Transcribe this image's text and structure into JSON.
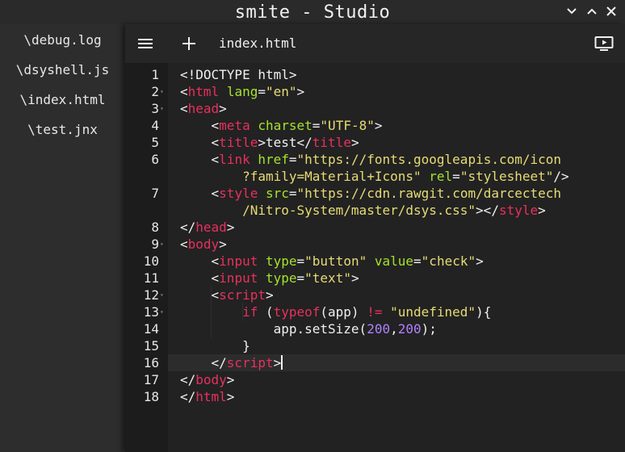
{
  "window": {
    "title": "smite - Studio",
    "controls": [
      "chevron-down-icon",
      "chevron-up-icon",
      "close-icon"
    ]
  },
  "sidebar": {
    "files": [
      "\\debug.log",
      "\\dsyshell.js",
      "\\index.html",
      "\\test.jnx"
    ]
  },
  "toolbar": {
    "menu_icon": "menu-icon",
    "add_icon": "plus-icon",
    "tab_label": "index.html",
    "run_icon": "play-screen-icon"
  },
  "editor": {
    "active_line": 16,
    "colors": {
      "tag": "#e8305e",
      "attribute": "#a6e22e",
      "string": "#e6db74",
      "number": "#ae81ff",
      "text": "#f0f0f0"
    },
    "lines": [
      {
        "num": "1",
        "fold": false,
        "wrap": false,
        "parts": [
          [
            "text",
            "<!DOCTYPE html>"
          ]
        ]
      },
      {
        "num": "2",
        "fold": true,
        "wrap": false,
        "parts": [
          [
            "text",
            "<"
          ],
          [
            "tag",
            "html"
          ],
          [
            "text",
            " "
          ],
          [
            "attr",
            "lang"
          ],
          [
            "text",
            "="
          ],
          [
            "str",
            "\"en\""
          ],
          [
            "text",
            ">"
          ]
        ]
      },
      {
        "num": "3",
        "fold": true,
        "wrap": false,
        "parts": [
          [
            "text",
            "<"
          ],
          [
            "tag",
            "head"
          ],
          [
            "text",
            ">"
          ]
        ]
      },
      {
        "num": "4",
        "fold": false,
        "wrap": false,
        "parts": [
          [
            "text",
            "    <"
          ],
          [
            "tag",
            "meta"
          ],
          [
            "text",
            " "
          ],
          [
            "attr",
            "charset"
          ],
          [
            "text",
            "="
          ],
          [
            "str",
            "\"UTF-8\""
          ],
          [
            "text",
            ">"
          ]
        ]
      },
      {
        "num": "5",
        "fold": false,
        "wrap": false,
        "parts": [
          [
            "text",
            "    <"
          ],
          [
            "tag",
            "title"
          ],
          [
            "text",
            ">test</"
          ],
          [
            "tag",
            "title"
          ],
          [
            "text",
            ">"
          ]
        ]
      },
      {
        "num": "6",
        "fold": false,
        "wrap": false,
        "parts": [
          [
            "text",
            "    <"
          ],
          [
            "tag",
            "link"
          ],
          [
            "text",
            " "
          ],
          [
            "attr",
            "href"
          ],
          [
            "text",
            "="
          ],
          [
            "str",
            "\"https://fonts.googleapis.com/icon"
          ]
        ]
      },
      {
        "num": "",
        "fold": false,
        "wrap": true,
        "parts": [
          [
            "text",
            "        "
          ],
          [
            "str",
            "?family=Material+Icons\""
          ],
          [
            "text",
            " "
          ],
          [
            "attr",
            "rel"
          ],
          [
            "text",
            "="
          ],
          [
            "str",
            "\"stylesheet\""
          ],
          [
            "text",
            "/>"
          ]
        ]
      },
      {
        "num": "7",
        "fold": false,
        "wrap": false,
        "parts": [
          [
            "text",
            "    <"
          ],
          [
            "tag",
            "style"
          ],
          [
            "text",
            " "
          ],
          [
            "attr",
            "src"
          ],
          [
            "text",
            "="
          ],
          [
            "str",
            "\"https://cdn.rawgit.com/darcectech"
          ]
        ]
      },
      {
        "num": "",
        "fold": false,
        "wrap": true,
        "parts": [
          [
            "text",
            "        "
          ],
          [
            "str",
            "/Nitro-System/master/dsys.css\""
          ],
          [
            "text",
            "></"
          ],
          [
            "tag",
            "style"
          ],
          [
            "text",
            ">"
          ]
        ]
      },
      {
        "num": "8",
        "fold": false,
        "wrap": false,
        "parts": [
          [
            "text",
            "</"
          ],
          [
            "tag",
            "head"
          ],
          [
            "text",
            ">"
          ]
        ]
      },
      {
        "num": "9",
        "fold": true,
        "wrap": false,
        "parts": [
          [
            "text",
            "<"
          ],
          [
            "tag",
            "body"
          ],
          [
            "text",
            ">"
          ]
        ]
      },
      {
        "num": "10",
        "fold": false,
        "wrap": false,
        "parts": [
          [
            "text",
            "    <"
          ],
          [
            "tag",
            "input"
          ],
          [
            "text",
            " "
          ],
          [
            "attr",
            "type"
          ],
          [
            "text",
            "="
          ],
          [
            "str",
            "\"button\""
          ],
          [
            "text",
            " "
          ],
          [
            "attr",
            "value"
          ],
          [
            "text",
            "="
          ],
          [
            "str",
            "\"check\""
          ],
          [
            "text",
            ">"
          ]
        ]
      },
      {
        "num": "11",
        "fold": false,
        "wrap": false,
        "parts": [
          [
            "text",
            "    <"
          ],
          [
            "tag",
            "input"
          ],
          [
            "text",
            " "
          ],
          [
            "attr",
            "type"
          ],
          [
            "text",
            "="
          ],
          [
            "str",
            "\"text\""
          ],
          [
            "text",
            ">"
          ]
        ]
      },
      {
        "num": "12",
        "fold": true,
        "wrap": false,
        "parts": [
          [
            "text",
            "    <"
          ],
          [
            "tag",
            "script"
          ],
          [
            "text",
            ">"
          ]
        ]
      },
      {
        "num": "13",
        "fold": true,
        "wrap": false,
        "parts": [
          [
            "text",
            "        "
          ],
          [
            "kw",
            "if"
          ],
          [
            "text",
            " ("
          ],
          [
            "kw",
            "typeof"
          ],
          [
            "text",
            "(app) "
          ],
          [
            "kw",
            "!="
          ],
          [
            "text",
            " "
          ],
          [
            "str",
            "\"undefined\""
          ],
          [
            "text",
            "){"
          ]
        ]
      },
      {
        "num": "14",
        "fold": false,
        "wrap": false,
        "parts": [
          [
            "text",
            "            app.setSize("
          ],
          [
            "num",
            "200"
          ],
          [
            "text",
            ","
          ],
          [
            "num",
            "200"
          ],
          [
            "text",
            ");"
          ]
        ]
      },
      {
        "num": "15",
        "fold": false,
        "wrap": false,
        "parts": [
          [
            "text",
            "        }"
          ]
        ]
      },
      {
        "num": "16",
        "fold": false,
        "wrap": false,
        "parts": [
          [
            "text",
            "    </"
          ],
          [
            "tag",
            "script"
          ],
          [
            "text",
            ">"
          ]
        ],
        "caret": true
      },
      {
        "num": "17",
        "fold": false,
        "wrap": false,
        "parts": [
          [
            "text",
            "</"
          ],
          [
            "tag",
            "body"
          ],
          [
            "text",
            ">"
          ]
        ]
      },
      {
        "num": "18",
        "fold": false,
        "wrap": false,
        "parts": [
          [
            "text",
            "</"
          ],
          [
            "tag",
            "html"
          ],
          [
            "text",
            ">"
          ]
        ]
      }
    ]
  }
}
